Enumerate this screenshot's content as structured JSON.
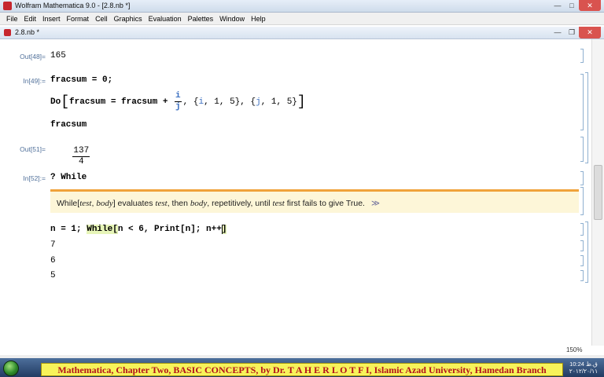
{
  "window": {
    "title": "Wolfram Mathematica 9.0 - [2.8.nb *]"
  },
  "menu": [
    "File",
    "Edit",
    "Insert",
    "Format",
    "Cell",
    "Graphics",
    "Evaluation",
    "Palettes",
    "Window",
    "Help"
  ],
  "notebook": {
    "title": "2.8.nb *",
    "cells": {
      "out48": {
        "label": "Out[48]=",
        "value": "165"
      },
      "in49": {
        "label": "In[49]:=",
        "line1": "fracsum = 0;",
        "do_prefix": "Do",
        "do_body": "fracsum = fracsum + ",
        "frac_num": "i",
        "frac_den": "j",
        "do_iter_open": ", {",
        "iter_i": "i",
        "iter_i_rest": ", 1, 5}, {",
        "iter_j": "j",
        "iter_j_rest": ", 1, 5}",
        "line3": "fracsum"
      },
      "out51": {
        "label": "Out[51]=",
        "numerator": "137",
        "denominator": "4"
      },
      "in52": {
        "label": "In[52]:=",
        "code": "? While"
      },
      "info": {
        "prefix": "While[",
        "arg1": "test",
        "sep": ", ",
        "arg2": "body",
        "mid1": "] evaluates ",
        "arg3": "test",
        "mid2": ", then ",
        "arg4": "body",
        "mid3": ", repetitively, until ",
        "arg5": "test",
        "suffix": " first fails to give True.",
        "more": "≫"
      },
      "in53": {
        "pre": "n = 1; ",
        "kw": "While",
        "open": "[",
        "rest": "n < 6, Print[n]; n++",
        "close": "]"
      },
      "prints": [
        "7",
        "6",
        "5"
      ]
    }
  },
  "status": {
    "zoom": "150%"
  },
  "taskbar": {
    "banner": "Mathematica, Chapter Two, BASIC CONCEPTS,  by Dr. T A H E R    L O T F I, Islamic Azad University, Hamedan Branch",
    "time": "10:24 ق.ظ",
    "date": "۲۰۱۲/۲۰/۱۱"
  }
}
